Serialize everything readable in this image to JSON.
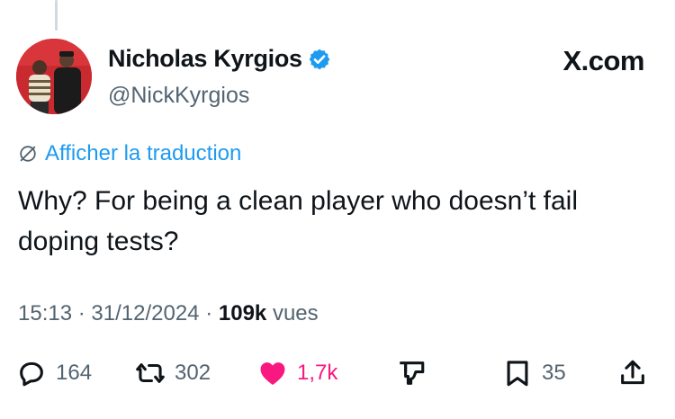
{
  "author": {
    "display_name": "Nicholas Kyrgios",
    "handle": "@NickKyrgios",
    "verified_color": "#1d9bf0"
  },
  "source_label": "X.com",
  "translate_label": "Afficher la traduction",
  "tweet": {
    "text": "Why? For being a clean player who doesn’t fail doping tests?"
  },
  "meta": {
    "time": "15:13",
    "date": "31/12/2024",
    "views_count": "109k",
    "views_label": "vues"
  },
  "actions": {
    "replies": "164",
    "reposts": "302",
    "likes": "1,7k",
    "bookmarks": "35"
  },
  "colors": {
    "accent": "#1d9bf0",
    "like": "#f91880",
    "muted": "#536471",
    "text": "#0f1419"
  },
  "icons": [
    "reply-icon",
    "repost-icon",
    "like-icon",
    "downvote-icon",
    "bookmark-icon",
    "share-icon",
    "verified-icon",
    "translate-icon"
  ]
}
